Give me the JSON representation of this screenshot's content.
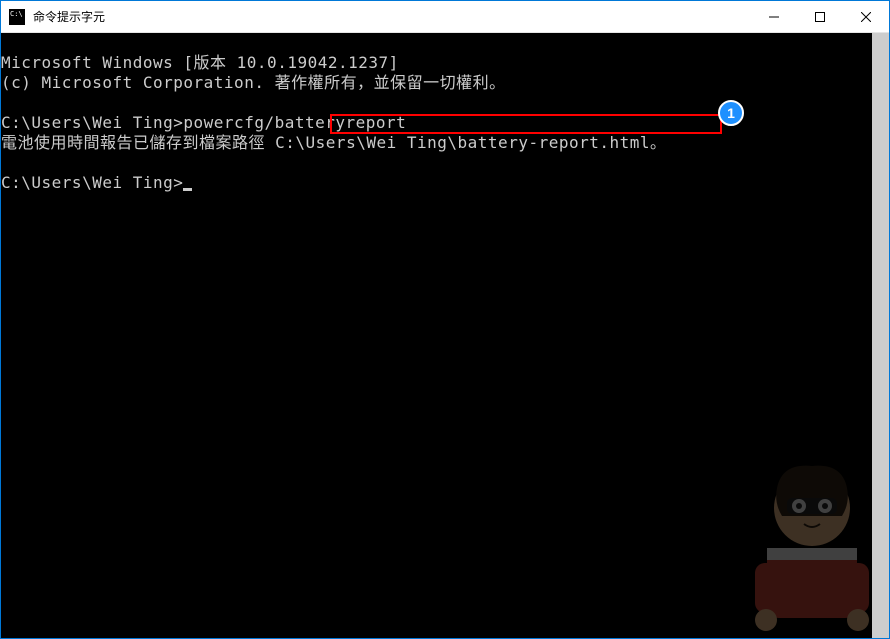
{
  "window": {
    "title": "命令提示字元"
  },
  "terminal": {
    "lines": [
      "Microsoft Windows [版本 10.0.19042.1237]",
      "(c) Microsoft Corporation. 著作權所有，並保留一切權利。",
      "",
      "C:\\Users\\Wei Ting>powercfg/batteryreport",
      "電池使用時間報告已儲存到檔案路徑 C:\\Users\\Wei Ting\\battery-report.html。",
      "",
      "C:\\Users\\Wei Ting>"
    ],
    "prompt_prefix": "C:\\Users\\Wei Ting>",
    "highlighted_text": "C:\\Users\\Wei Ting\\battery-report.html"
  },
  "annotation": {
    "badge_number": "1"
  }
}
